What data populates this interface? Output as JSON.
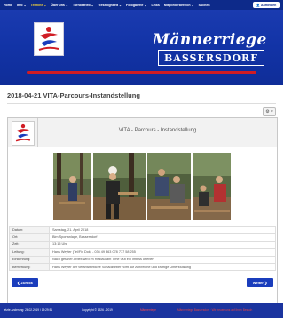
{
  "nav": {
    "items": [
      {
        "label": "Home"
      },
      {
        "label": "Info ⌄"
      },
      {
        "label": "Termine ⌄"
      },
      {
        "label": "Über uns ⌄"
      },
      {
        "label": "Turnbetrieb ⌄"
      },
      {
        "label": "Gesellighkeit ⌄"
      },
      {
        "label": "Fotogalerie ⌄"
      },
      {
        "label": "Links"
      },
      {
        "label": "Mitgliederbereich ⌄"
      },
      {
        "label": "Suchen"
      }
    ],
    "login_label": "👤 Anmelden",
    "active_color": "#f2d23a"
  },
  "banner": {
    "script_title": "Männerriege",
    "box_title": "BASSERSDORF"
  },
  "page": {
    "title": "2018-04-21 VITA-Parcours-Instandstellung",
    "gear_label": "⚙ ▾"
  },
  "card": {
    "head_title": "VITA - Parcours - Instandstellung",
    "rows": [
      {
        "key": "Datum:",
        "value": "Samstag, 21. April 2018"
      },
      {
        "key": "Ort:",
        "value": "Bim Sportanlage, Bassersdorf"
      },
      {
        "key": "Zeit:",
        "value": "13:15 Uhr"
      },
      {
        "key": "Leitung:",
        "value": "Hans Weyler (Tel/Fix Dok) - 036 49 363 078 777 58 255"
      },
      {
        "key": "Einkehrung:",
        "value": "Nach getaner Arbeit wird im Restaurant Time Out ein Imbiss offeriert"
      },
      {
        "key": "Bemerkung:",
        "value": "Hans Weyler der verantwortliche Schadzürber hofft auf zahlreiche und kräftige Unterstützung"
      }
    ],
    "back_label": "❮ Zurück",
    "next_label": "Weiter ❯"
  },
  "footer": {
    "updated": "letzte Änderung: 26.02.2019 / 19:29:51",
    "copyright": "Copyright © 1926 - 2019",
    "link": "Männerriege",
    "right": "Männerriege Bassersdorf · Wir freuen uns auf Ihren Besuch"
  },
  "colors": {
    "nav_bg": "#0d2a8a",
    "banner_bg": "#1233a6",
    "accent_red": "#d01c24",
    "button_blue": "#1a3dbc",
    "footer_bg": "#1b349f"
  }
}
